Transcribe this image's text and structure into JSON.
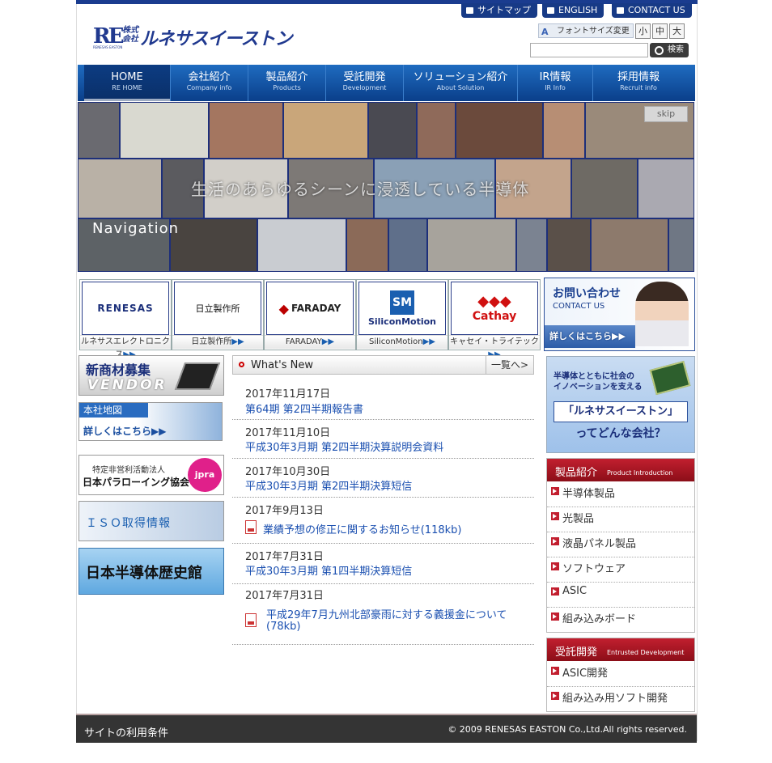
{
  "header": {
    "sitemap": "サイトマップ",
    "english": "ENGLISH",
    "contact": "CONTACT US",
    "logo_mark": "RE",
    "logo_sub": "RENESAS EASTON",
    "logo_kk": "株式会社",
    "logo_name": "ルネサスイーストン",
    "font_size_label": "フォントサイズ変更",
    "font_small": "小",
    "font_medium": "中",
    "font_large": "大",
    "search_placeholder": "",
    "search_button": "検索"
  },
  "nav": [
    {
      "jp": "HOME",
      "en": "RE HOME"
    },
    {
      "jp": "会社紹介",
      "en": "Company info"
    },
    {
      "jp": "製品紹介",
      "en": "Products"
    },
    {
      "jp": "受託開発",
      "en": "Development"
    },
    {
      "jp": "ソリューション紹介",
      "en": "About Solution"
    },
    {
      "jp": "IR情報",
      "en": "IR Info"
    },
    {
      "jp": "採用情報",
      "en": "Recruit info"
    }
  ],
  "hero": {
    "tagline": "生活のあらゆるシーンに浸透している半導体",
    "navigation": "Navigation",
    "skip": "skip"
  },
  "partners": [
    {
      "logo": "RENESAS",
      "caption": "ルネサスエレクトロニクス"
    },
    {
      "logo": "日立製作所",
      "caption": "日立製作所"
    },
    {
      "logo": "FARADAY",
      "caption": "FARADAY"
    },
    {
      "logo": "SiliconMotion",
      "caption": "SiliconMotion"
    },
    {
      "logo": "Cathay",
      "caption": "キャセイ・トライテック"
    }
  ],
  "contact_banner": {
    "jp": "お問い合わせ",
    "en": "CONTACT US",
    "detail": "詳しくはこちら"
  },
  "left_banners": {
    "vendor_jp": "新商材募集",
    "vendor_en": "VENDOR",
    "map_title": "本社地図",
    "map_detail": "詳しくはこちら",
    "para_npo": "特定非営利活動法人",
    "para_name": "日本パラローイング協会",
    "para_logo": "jpra",
    "iso": "ＩＳＯ取得情報",
    "history": "日本半導体歴史館"
  },
  "news": {
    "title": "What's New",
    "more": "一覧へ",
    "items": [
      {
        "date": "2017年11月17日",
        "title": "第64期 第2四半期報告書",
        "pdf": false
      },
      {
        "date": "2017年11月10日",
        "title": "平成30年3月期 第2四半期決算説明会資料",
        "pdf": false
      },
      {
        "date": "2017年10月30日",
        "title": "平成30年3月期 第2四半期決算短信",
        "pdf": false
      },
      {
        "date": "2017年9月13日",
        "title": "業績予想の修正に関するお知らせ(118kb)",
        "pdf": true
      },
      {
        "date": "2017年7月31日",
        "title": "平成30年3月期 第1四半期決算短信",
        "pdf": false
      },
      {
        "date": "2017年7月31日",
        "title": "平成29年7月九州北部豪雨に対する義援金について",
        "title2": "(78kb)",
        "pdf": true
      }
    ]
  },
  "about_banner": {
    "line1": "半導体とともに社会の",
    "line2": "イノベーションを支える",
    "name": "「ルネサスイーストン」",
    "question": "ってどんな会社？"
  },
  "products": {
    "title": "製品紹介",
    "title_en": "Product Introduction",
    "items": [
      "半導体製品",
      "光製品",
      "液晶パネル製品",
      "ソフトウェア",
      "ASIC",
      "組み込みボード"
    ]
  },
  "development": {
    "title": "受託開発",
    "title_en": "Entrusted Development",
    "items": [
      "ASIC開発",
      "組み込み用ソフト開発"
    ]
  },
  "footer": {
    "terms": "サイトの利用条件",
    "copyright": "© 2009  RENESAS EASTON  Co.,Ltd.All rights reserved."
  }
}
